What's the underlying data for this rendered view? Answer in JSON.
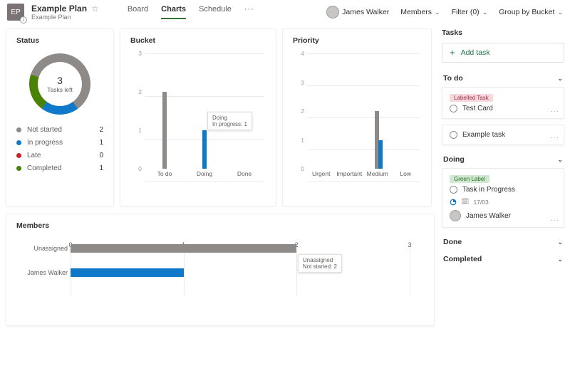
{
  "header": {
    "plan_initials": "EP",
    "plan_title": "Example Plan",
    "plan_subtitle": "Example Plan",
    "tabs": [
      "Board",
      "Charts",
      "Schedule"
    ],
    "active_tab": "Charts",
    "user_name": "James Walker",
    "members_label": "Members",
    "filter_label": "Filter (0)",
    "group_label": "Group by Bucket"
  },
  "status_card": {
    "title": "Status",
    "center_value": "3",
    "center_label": "Tasks left",
    "legend": [
      {
        "label": "Not started",
        "value": "2",
        "color": "#8d8a88"
      },
      {
        "label": "In progress",
        "value": "1",
        "color": "#1078c8"
      },
      {
        "label": "Late",
        "value": "0",
        "color": "#c5262c"
      },
      {
        "label": "Completed",
        "value": "1",
        "color": "#498205"
      }
    ]
  },
  "bucket_card": {
    "title": "Bucket",
    "tooltip": {
      "line1": "Doing",
      "line2": "In progress: 1"
    }
  },
  "priority_card": {
    "title": "Priority"
  },
  "members_card": {
    "title": "Members",
    "tooltip": {
      "line1": "Unassigned",
      "line2": "Not started: 2"
    }
  },
  "tasks_panel": {
    "title": "Tasks",
    "add_label": "Add task",
    "sections": {
      "todo": "To do",
      "doing": "Doing",
      "done": "Done",
      "completed": "Completed"
    },
    "todo_tasks": [
      {
        "pill": "Labelled Task",
        "pill_class": "pill-red",
        "title": "Test Card"
      },
      {
        "title": "Example task"
      }
    ],
    "doing_task": {
      "pill": "Green Label",
      "pill_class": "pill-green",
      "title": "Task in Progress",
      "date": "17/03",
      "assignee": "James Walker"
    }
  },
  "chart_data": [
    {
      "type": "pie",
      "title": "Status",
      "series": [
        {
          "name": "Not started",
          "value": 2,
          "color": "#8d8a88"
        },
        {
          "name": "In progress",
          "value": 1,
          "color": "#1078c8"
        },
        {
          "name": "Late",
          "value": 0,
          "color": "#c5262c"
        },
        {
          "name": "Completed",
          "value": 1,
          "color": "#498205"
        }
      ],
      "center_label": "3 Tasks left"
    },
    {
      "type": "bar",
      "title": "Bucket",
      "categories": [
        "To do",
        "Doing",
        "Done"
      ],
      "ylim": [
        0,
        3
      ],
      "yticks": [
        0,
        1,
        2,
        3
      ],
      "series": [
        {
          "name": "Not started",
          "color": "#8d8a88",
          "values": [
            2,
            0,
            0
          ]
        },
        {
          "name": "In progress",
          "color": "#1078c8",
          "values": [
            0,
            1,
            0
          ]
        }
      ]
    },
    {
      "type": "bar",
      "title": "Priority",
      "categories": [
        "Urgent",
        "Important",
        "Medium",
        "Low"
      ],
      "ylim": [
        0,
        4
      ],
      "yticks": [
        0,
        1,
        2,
        3,
        4
      ],
      "series": [
        {
          "name": "Not started",
          "color": "#8d8a88",
          "values": [
            0,
            0,
            2,
            0
          ]
        },
        {
          "name": "In progress",
          "color": "#1078c8",
          "values": [
            0,
            0,
            1,
            0
          ]
        }
      ]
    },
    {
      "type": "bar",
      "orientation": "horizontal",
      "title": "Members",
      "categories": [
        "Unassigned",
        "James Walker"
      ],
      "xlim": [
        0,
        3
      ],
      "xticks": [
        0,
        1,
        2,
        3
      ],
      "series": [
        {
          "name": "Not started",
          "color": "#8d8a88",
          "values": [
            2,
            0
          ]
        },
        {
          "name": "In progress",
          "color": "#1078c8",
          "values": [
            0,
            1
          ]
        }
      ]
    }
  ]
}
